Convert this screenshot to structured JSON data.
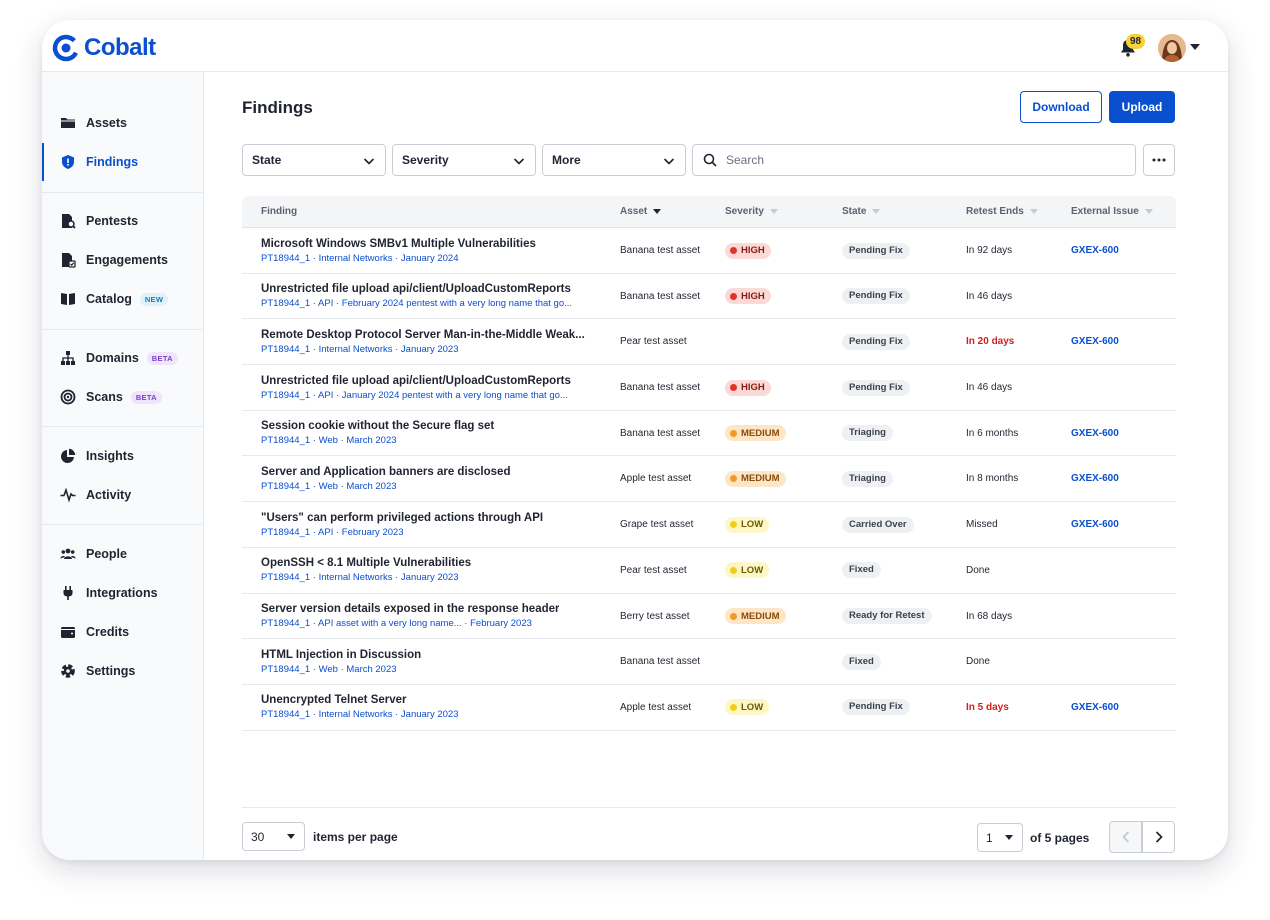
{
  "brand": {
    "name": "Cobalt"
  },
  "header": {
    "notification_count": "98"
  },
  "sidebar": {
    "items": [
      {
        "label": "Assets",
        "icon": "folder-icon"
      },
      {
        "label": "Findings",
        "icon": "shield-icon",
        "active": true
      },
      {
        "label": "Pentests",
        "icon": "pentest-icon"
      },
      {
        "label": "Engagements",
        "icon": "engagements-icon"
      },
      {
        "label": "Catalog",
        "icon": "book-icon",
        "badge": "NEW"
      },
      {
        "label": "Domains",
        "icon": "sitemap-icon",
        "badge": "BETA"
      },
      {
        "label": "Scans",
        "icon": "target-icon",
        "badge": "BETA"
      },
      {
        "label": "Insights",
        "icon": "pie-chart-icon"
      },
      {
        "label": "Activity",
        "icon": "pulse-icon"
      },
      {
        "label": "People",
        "icon": "people-icon"
      },
      {
        "label": "Integrations",
        "icon": "plug-icon"
      },
      {
        "label": "Credits",
        "icon": "wallet-icon"
      },
      {
        "label": "Settings",
        "icon": "gear-icon"
      }
    ]
  },
  "main": {
    "title": "Findings",
    "download_label": "Download",
    "upload_label": "Upload",
    "filters": {
      "state": "State",
      "severity": "Severity",
      "more": "More"
    },
    "search_placeholder": "Search"
  },
  "table": {
    "columns": {
      "finding": "Finding",
      "asset": "Asset",
      "severity": "Severity",
      "state": "State",
      "retest": "Retest Ends",
      "external": "External Issue"
    },
    "rows": [
      {
        "title": "Microsoft Windows SMBv1 Multiple Vulnerabilities",
        "meta": "PT18944_1 · Internal Networks · January 2024",
        "asset": "Banana test asset",
        "severity": "HIGH",
        "state": "Pending Fix",
        "retest": "In 92 days",
        "external": "GXEX-600"
      },
      {
        "title": "Unrestricted file upload api/client/UploadCustomReports",
        "meta": "PT18944_1 · API · February 2024 pentest with a very long name that go...",
        "asset": "Banana test asset",
        "severity": "HIGH",
        "state": "Pending Fix",
        "retest": "In 46 days",
        "external": ""
      },
      {
        "title": "Remote Desktop Protocol Server Man-in-the-Middle Weak...",
        "meta": "PT18944_1 · Internal Networks · January 2023",
        "asset": "Pear test asset",
        "severity": "",
        "state": "Pending Fix",
        "retest": "In 20 days",
        "retest_urgent": true,
        "external": "GXEX-600"
      },
      {
        "title": "Unrestricted file upload api/client/UploadCustomReports",
        "meta": "PT18944_1 · API · January 2024 pentest with a very long name that go...",
        "asset": "Banana test asset",
        "severity": "HIGH",
        "state": "Pending Fix",
        "retest": "In 46 days",
        "external": ""
      },
      {
        "title": "Session cookie without the Secure flag set",
        "meta": "PT18944_1 · Web · March 2023",
        "asset": "Banana test asset",
        "severity": "MEDIUM",
        "state": "Triaging",
        "retest": "In 6 months",
        "external": "GXEX-600"
      },
      {
        "title": "Server and Application banners are disclosed",
        "meta": "PT18944_1 · Web · March 2023",
        "asset": "Apple test asset",
        "severity": "MEDIUM",
        "state": "Triaging",
        "retest": "In 8 months",
        "external": "GXEX-600"
      },
      {
        "title": "\"Users\" can perform privileged actions through API",
        "meta": "PT18944_1 · API · February 2023",
        "asset": "Grape test asset",
        "severity": "LOW",
        "state": "Carried Over",
        "retest": "Missed",
        "external": "GXEX-600"
      },
      {
        "title": "OpenSSH < 8.1 Multiple Vulnerabilities",
        "meta": "PT18944_1 · Internal Networks · January 2023",
        "asset": "Pear test asset",
        "severity": "LOW",
        "state": "Fixed",
        "retest": "Done",
        "external": ""
      },
      {
        "title": "Server version details exposed in the response header",
        "meta": "PT18944_1 · API asset with a very long name... · February 2023",
        "asset": "Berry test asset",
        "severity": "MEDIUM",
        "state": "Ready for Retest",
        "retest": "In 68 days",
        "external": ""
      },
      {
        "title": "HTML Injection in Discussion",
        "meta": "PT18944_1 · Web · March 2023",
        "asset": "Banana test asset",
        "severity": "",
        "state": "Fixed",
        "retest": "Done",
        "external": ""
      },
      {
        "title": "Unencrypted Telnet Server",
        "meta": "PT18944_1 · Internal Networks · January 2023",
        "asset": "Apple test asset",
        "severity": "LOW",
        "state": "Pending Fix",
        "retest": "In 5 days",
        "retest_urgent": true,
        "external": "GXEX-600"
      }
    ]
  },
  "pagination": {
    "per_page": "30",
    "per_page_label": "items per page",
    "current_page": "1",
    "pages_label": "of 5 pages"
  },
  "colors": {
    "accent": "#0a4fd0",
    "high": "#e2322a",
    "medium": "#f29b1f",
    "low": "#f2cf16",
    "urgent": "#d11f1f"
  }
}
